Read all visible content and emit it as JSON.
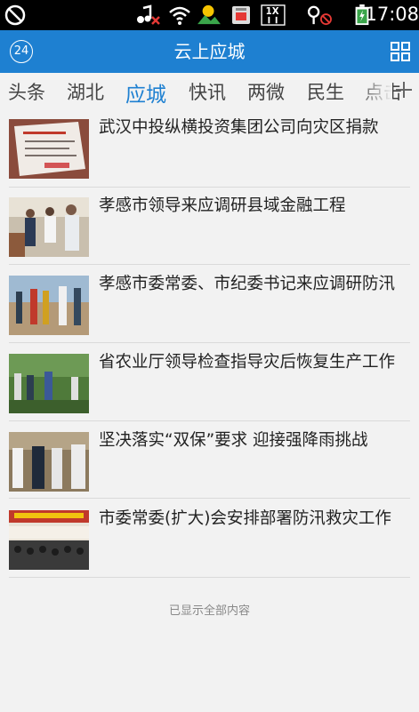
{
  "status_bar": {
    "time": "17:08",
    "icons": [
      "music-muted-icon",
      "wifi-icon",
      "weather-icon",
      "sim-icon",
      "network-1x-icon",
      "gps-off-icon",
      "battery-charging-icon"
    ]
  },
  "app_bar": {
    "title": "云上应城",
    "badge": "24",
    "colors": {
      "bar": "#1e80d1",
      "active_tab": "#1e80d1"
    }
  },
  "tabs": [
    {
      "label": "头条"
    },
    {
      "label": "湖北"
    },
    {
      "label": "应城",
      "active": true
    },
    {
      "label": "快讯"
    },
    {
      "label": "两微"
    },
    {
      "label": "民生"
    },
    {
      "label": "点击"
    }
  ],
  "news": [
    {
      "title": "武汉中投纵横投资集团公司向灾区捐款",
      "thumb": "donation-certificate-photo"
    },
    {
      "title": "孝感市领导来应调研县域金融工程",
      "thumb": "officials-meeting-photo"
    },
    {
      "title": "孝感市委常委、市纪委书记来应调研防汛",
      "thumb": "riverbank-inspection-photo"
    },
    {
      "title": "省农业厅领导检查指导灾后恢复生产工作",
      "thumb": "field-inspection-photo"
    },
    {
      "title": "坚决落实“双保”要求 迎接强降雨挑战",
      "thumb": "officials-standing-photo"
    },
    {
      "title": "市委常委(扩大)会安排部署防汛救灾工作",
      "thumb": "conference-hall-photo"
    }
  ],
  "footer": {
    "note": "已显示全部内容"
  }
}
